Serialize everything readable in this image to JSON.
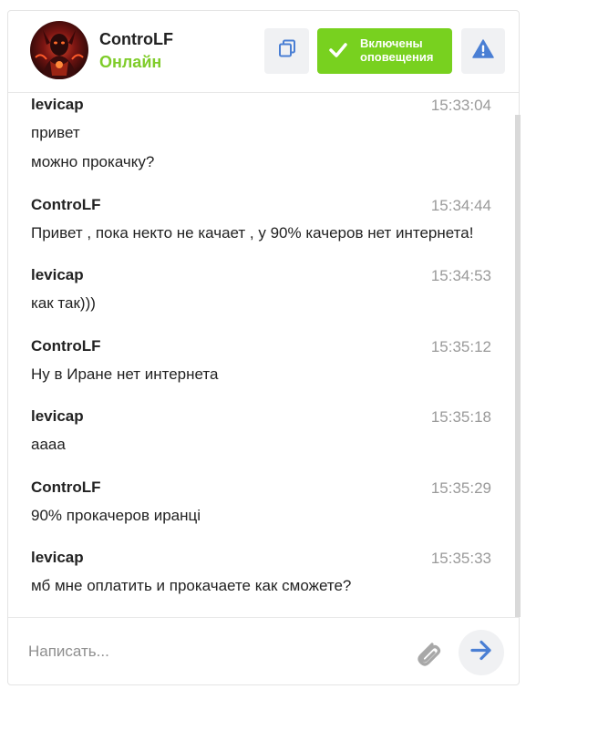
{
  "header": {
    "user_name": "ControLF",
    "user_status": "Онлайн",
    "notify_label_line1": "Включены",
    "notify_label_line2": "оповещения"
  },
  "icons": {
    "copy": "copy-icon",
    "check": "check-icon",
    "report": "warning-icon",
    "attach": "paperclip-icon",
    "send": "arrow-right-icon"
  },
  "colors": {
    "online": "#7fcc2a",
    "notify_button": "#78d11f",
    "accent_blue": "#4a7fd4",
    "timestamp": "#9a9a9a"
  },
  "messages": [
    {
      "author": "levicap",
      "time": "15:33:04",
      "lines": [
        "привет",
        "можно прокачку?"
      ]
    },
    {
      "author": "ControLF",
      "time": "15:34:44",
      "lines": [
        "Привет , пока некто не качает , у 90% качеров нет интернета!"
      ]
    },
    {
      "author": "levicap",
      "time": "15:34:53",
      "lines": [
        "как так)))"
      ]
    },
    {
      "author": "ControLF",
      "time": "15:35:12",
      "lines": [
        "Ну в Иране нет интернета"
      ]
    },
    {
      "author": "levicap",
      "time": "15:35:18",
      "lines": [
        "аааа"
      ]
    },
    {
      "author": "ControLF",
      "time": "15:35:29",
      "lines": [
        "90% прокачеров иранці"
      ]
    },
    {
      "author": "levicap",
      "time": "15:35:33",
      "lines": [
        "мб мне оплатить и прокачаете как сможете?"
      ]
    }
  ],
  "composer": {
    "placeholder": "Написать..."
  }
}
